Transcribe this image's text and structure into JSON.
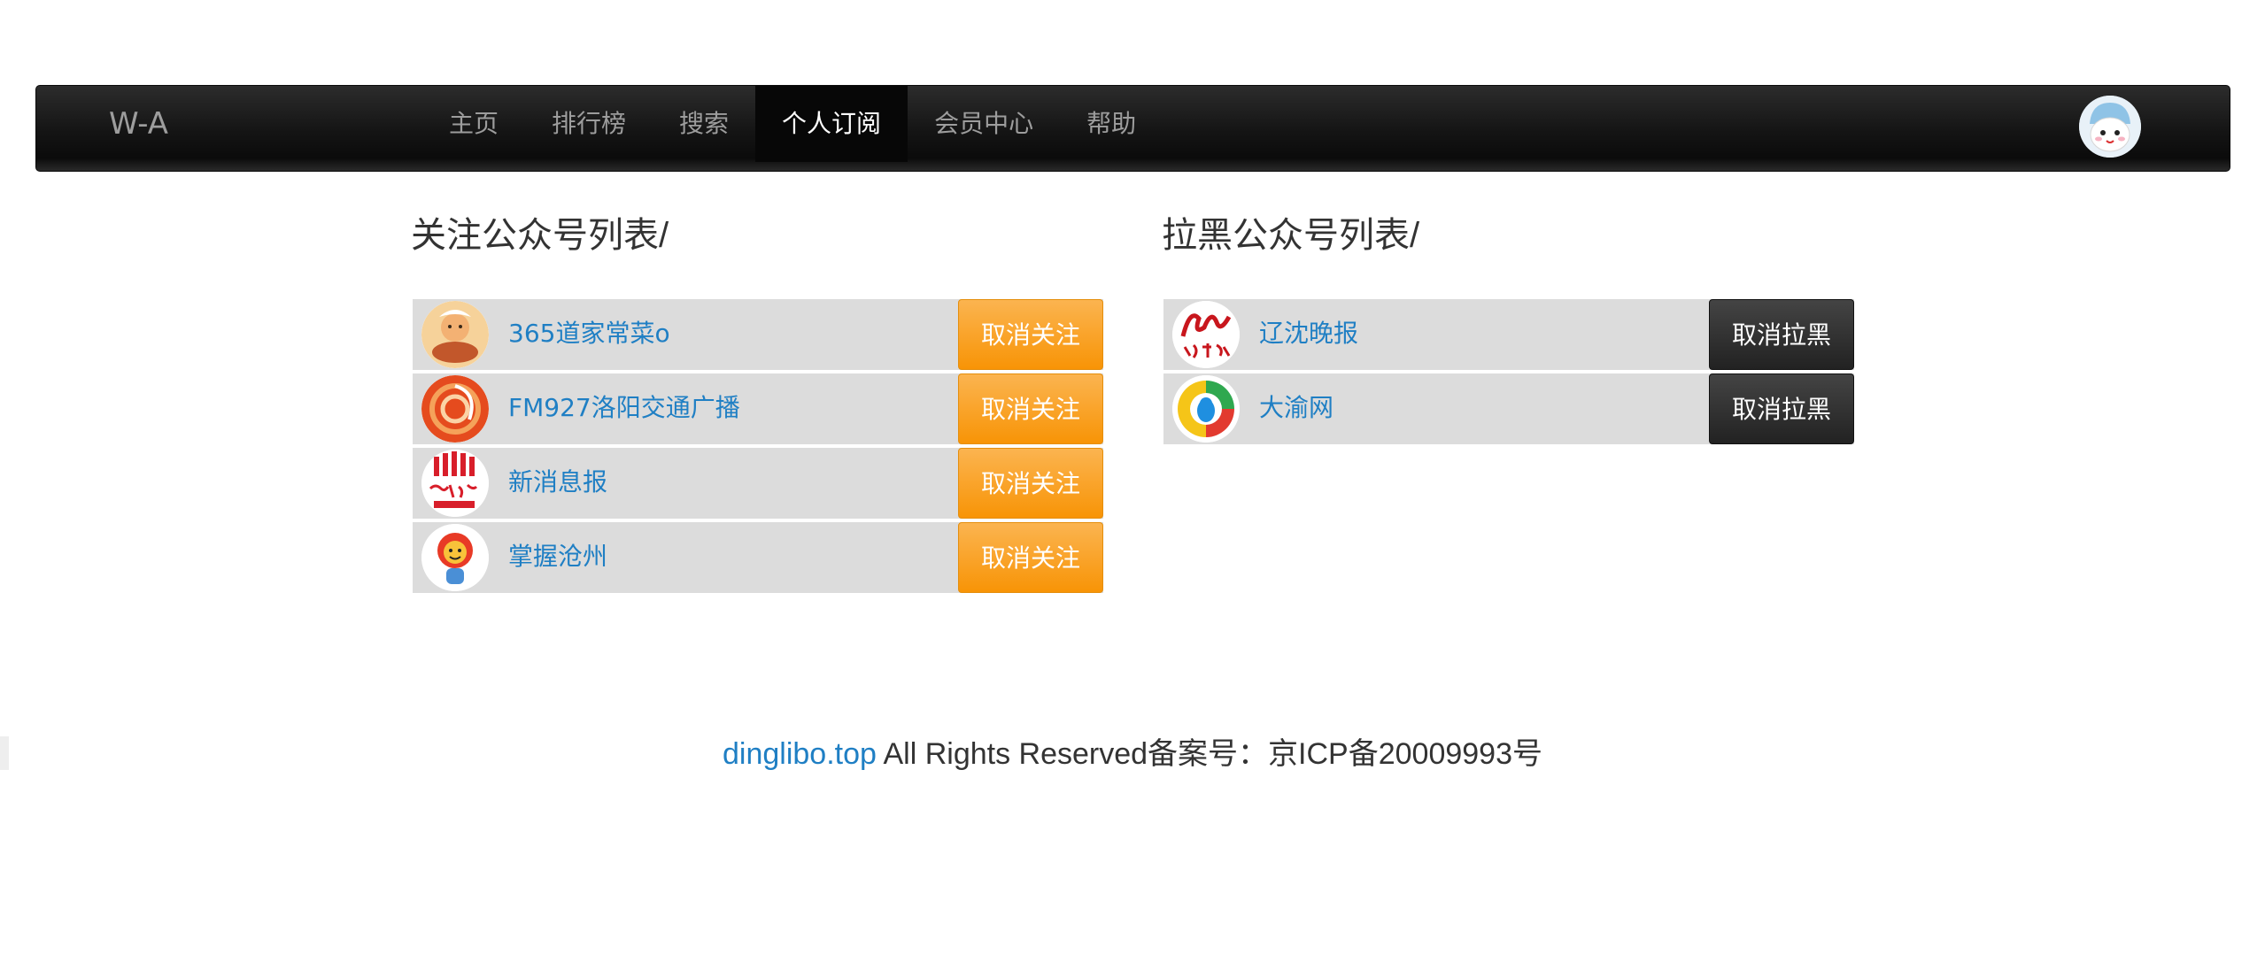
{
  "navbar": {
    "brand": "W-A",
    "items": [
      {
        "label": "主页"
      },
      {
        "label": "排行榜"
      },
      {
        "label": "搜索"
      },
      {
        "label": "个人订阅",
        "active": true
      },
      {
        "label": "会员中心"
      },
      {
        "label": "帮助"
      }
    ],
    "avatar_icon": "user-avatar-icon"
  },
  "followed": {
    "title": "关注公众号列表/",
    "button_label": "取消关注",
    "accent_color": "#f89406",
    "items": [
      {
        "name": "365道家常菜o",
        "icon": "cartoon-food-logo-icon"
      },
      {
        "name": "FM927洛阳交通广播",
        "icon": "radio-swirl-logo-icon"
      },
      {
        "name": "新消息报",
        "icon": "calligraphy-logo-icon"
      },
      {
        "name": "掌握沧州",
        "icon": "lion-mascot-logo-icon"
      }
    ]
  },
  "blocked": {
    "title": "拉黑公众号列表/",
    "button_label": "取消拉黑",
    "accent_color": "#222222",
    "items": [
      {
        "name": "辽沈晚报",
        "icon": "newspaper-logo-icon"
      },
      {
        "name": "大渝网",
        "icon": "qq-penguin-logo-icon"
      }
    ]
  },
  "footer": {
    "link_text": "dinglibo.top",
    "text": " All Rights Reserved备案号：京ICP备20009993号"
  }
}
